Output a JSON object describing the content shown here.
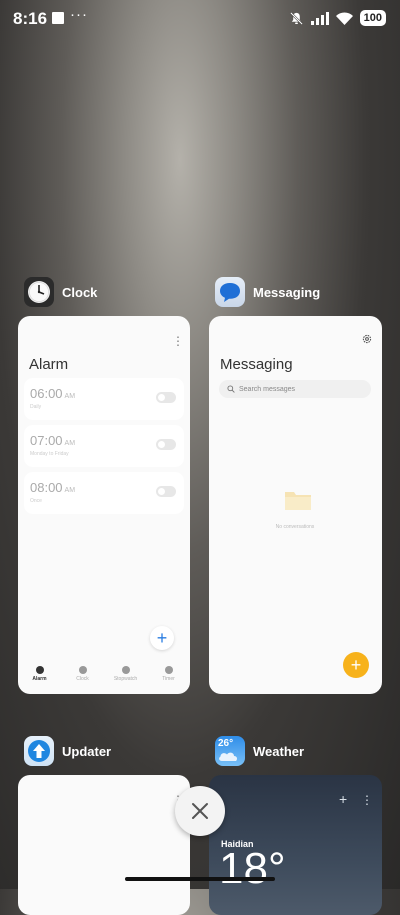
{
  "status_bar": {
    "time": "8:16",
    "ellipsis": "···",
    "battery": "100"
  },
  "apps": [
    {
      "name": "Clock",
      "icon": "clock-icon",
      "card": {
        "title": "Alarm",
        "alarms": [
          {
            "time": "06:00",
            "ampm": "AM",
            "sub": "Daily",
            "enabled": false
          },
          {
            "time": "07:00",
            "ampm": "AM",
            "sub": "Monday to Friday",
            "enabled": false
          },
          {
            "time": "08:00",
            "ampm": "AM",
            "sub": "Once",
            "enabled": false
          }
        ],
        "tabs": [
          {
            "label": "Alarm",
            "icon": "alarm-icon",
            "active": true
          },
          {
            "label": "Clock",
            "icon": "world-clock-icon",
            "active": false
          },
          {
            "label": "Stopwatch",
            "icon": "stopwatch-icon",
            "active": false
          },
          {
            "label": "Timer",
            "icon": "timer-icon",
            "active": false
          }
        ]
      }
    },
    {
      "name": "Messaging",
      "icon": "messaging-icon",
      "card": {
        "title": "Messaging",
        "search_placeholder": "Search messages",
        "empty_text": "No conversations"
      }
    },
    {
      "name": "Updater",
      "icon": "updater-icon"
    },
    {
      "name": "Weather",
      "icon": "weather-icon",
      "icon_text": "26°",
      "card": {
        "city": "Haidian",
        "temp": "18°"
      }
    }
  ],
  "colors": {
    "accent_blue": "#2a7de1",
    "accent_orange": "#f7b21b"
  }
}
